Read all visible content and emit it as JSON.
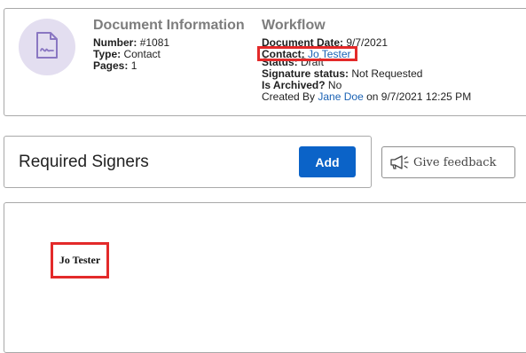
{
  "document_info": {
    "heading": "Document Information",
    "number_label": "Number:",
    "number_value": "#1081",
    "type_label": "Type:",
    "type_value": "Contact",
    "pages_label": "Pages:",
    "pages_value": "1",
    "icon": "document-signature-icon"
  },
  "workflow": {
    "heading": "Workflow",
    "date_label": "Document Date:",
    "date_value": "9/7/2021",
    "contact_label": "Contact:",
    "contact_value": "Jo Tester",
    "status_label": "Status:",
    "status_value": "Draft",
    "signature_label": "Signature status:",
    "signature_value": "Not Requested",
    "archived_label": "Is Archived?",
    "archived_value": "No",
    "created_prefix": "Created By",
    "created_by": "Jane Doe",
    "created_suffix": "on 9/7/2021 12:25 PM"
  },
  "signers": {
    "title": "Required Signers",
    "add_label": "Add",
    "items": [
      "Jo Tester"
    ]
  },
  "feedback": {
    "label": "Give feedback",
    "icon": "megaphone-icon"
  },
  "colors": {
    "accent": "#0b63c8",
    "link": "#1a62b4",
    "highlight": "#e32a2a",
    "avatar_bg": "#e3def0"
  }
}
